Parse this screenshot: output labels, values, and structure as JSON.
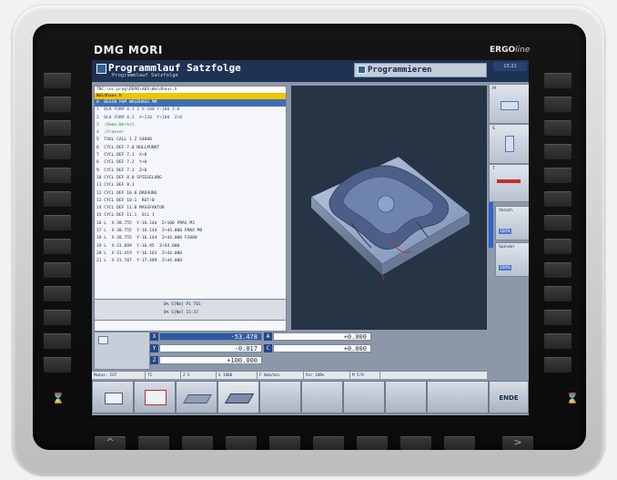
{
  "bezel": {
    "brand": "DMG MORI",
    "ergo_main": "ERGO",
    "ergo_tail": "line",
    "left_icon": "key-switch-icon",
    "right_icon": "key-switch-icon",
    "bottom_left_label": "^",
    "bottom_right_label": ">"
  },
  "header": {
    "mode_title": "Programmlauf Satzfolge",
    "mode_subtitle": "Programmlauf Satzfolge",
    "right_mode": "Programmieren",
    "corner_label": "15:21"
  },
  "program": {
    "path": "TNC:\\nc_prog\\DEMO\\ABS\\Waldhaus.h",
    "file": "Waldhaus.h",
    "lines": [
      {
        "text": "0  BEGIN PGM WALDHAUS MM",
        "style": "sel"
      },
      {
        "text": "1  BLK FORM 0.1 Z X-100 Y-100 Z-0",
        "style": "blu"
      },
      {
        "text": "2  BLK FORM 0.2  X+120  Y+100  Z+0",
        "style": "blu"
      },
      {
        "text": "3  ;Demo-Werkst.",
        "style": "cmt"
      },
      {
        "text": "4  ;Fraeser",
        "style": "cmt"
      },
      {
        "text": "5  TOOL CALL 1 Z S4000",
        "style": ""
      },
      {
        "text": "6  CYCL DEF 7.0 NULLPUNKT",
        "style": ""
      },
      {
        "text": "7  CYCL DEF 7.1  X+0",
        "style": ""
      },
      {
        "text": "8  CYCL DEF 7.2  Y+0",
        "style": ""
      },
      {
        "text": "9  CYCL DEF 7.3  Z+0",
        "style": ""
      },
      {
        "text": "10 CYCL DEF 8.0 SPIEGELUNG",
        "style": ""
      },
      {
        "text": "11 CYCL DEF 8.1",
        "style": ""
      },
      {
        "text": "12 CYCL DEF 10.0 DREHUNG",
        "style": ""
      },
      {
        "text": "13 CYCL DEF 10.1  ROT+0",
        "style": ""
      },
      {
        "text": "14 CYCL DEF 11.0 MASSFAKTOR",
        "style": ""
      },
      {
        "text": "15 CYCL DEF 11.1  SCL 1",
        "style": ""
      },
      {
        "text": "16 L  X-30.755  Y-16.144  Z+100 FMAX M3",
        "style": ""
      },
      {
        "text": "17 L  X-30.755  Y-16.144  Z+44.000 FMAX M8",
        "style": ""
      },
      {
        "text": "18 L  X-30.755  Y-16.144  Z+44.000 F2000",
        "style": ""
      },
      {
        "text": "19 L  X-31.099  Y-16.95  Z+44.000",
        "style": ""
      },
      {
        "text": "20 L  X-31.419  Y-16.163  Z+44.000",
        "style": ""
      },
      {
        "text": "21 L  X-31.707  Y-17.489  Z+44.000",
        "style": ""
      }
    ]
  },
  "status_lines": [
    "0% S[Nm]  P1  T01",
    "0% S[Nm]  15:37"
  ],
  "positions": [
    {
      "axis": "X",
      "value": "-53.478",
      "active": true
    },
    {
      "axis": "Y",
      "value": "-0.817",
      "active": false
    },
    {
      "axis": "Z",
      "value": "+100.000",
      "active": false
    },
    {
      "axis": "A",
      "value": "+0.000",
      "active": false
    },
    {
      "axis": "C",
      "value": "+0.000",
      "active": false
    }
  ],
  "status_bar": [
    "Modus: IST",
    "T1",
    "Z S",
    "S 1000",
    "F 0mm/min",
    "Ovr 100%",
    "M 5/9"
  ],
  "right_softkeys": [
    {
      "label": "M",
      "inner": ""
    },
    {
      "label": "S",
      "inner": ""
    },
    {
      "label": "T",
      "inner": ""
    },
    {
      "label": "Vorsch.",
      "inner": "100%"
    },
    {
      "label": "Spindel",
      "inner": "100%"
    }
  ],
  "ende_label": "ENDE"
}
